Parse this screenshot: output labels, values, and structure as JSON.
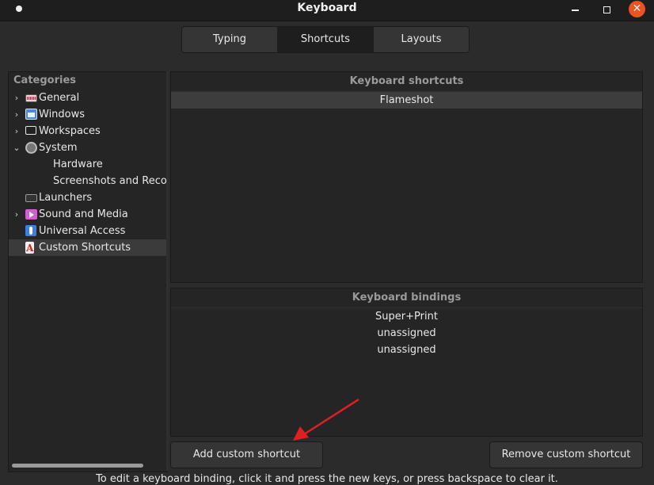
{
  "window": {
    "title": "Keyboard",
    "close_glyph": "✕",
    "close_color": "#e95420"
  },
  "tabs": [
    {
      "label": "Typing",
      "active": false
    },
    {
      "label": "Shortcuts",
      "active": true
    },
    {
      "label": "Layouts",
      "active": false
    }
  ],
  "categories": {
    "header": "Categories",
    "items": [
      {
        "label": "General",
        "icon": "keyboard-icon",
        "expander": "›"
      },
      {
        "label": "Windows",
        "icon": "windows-icon",
        "expander": "›"
      },
      {
        "label": "Workspaces",
        "icon": "monitor-icon",
        "expander": "›"
      },
      {
        "label": "System",
        "icon": "system-icon",
        "expander": "⌄"
      },
      {
        "label": "Hardware"
      },
      {
        "label": "Screenshots and Recording"
      },
      {
        "label": "Launchers",
        "icon": "launchers-icon"
      },
      {
        "label": "Sound and Media",
        "icon": "sound-icon",
        "expander": "›"
      },
      {
        "label": "Universal Access",
        "icon": "accessibility-icon"
      },
      {
        "label": "Custom Shortcuts",
        "icon": "custom-shortcuts-icon",
        "selected": true
      }
    ]
  },
  "shortcuts": {
    "header": "Keyboard shortcuts",
    "rows": [
      "Flameshot"
    ]
  },
  "bindings": {
    "header": "Keyboard bindings",
    "rows": [
      "Super+Print",
      "unassigned",
      "unassigned"
    ]
  },
  "buttons": {
    "add": "Add custom shortcut",
    "remove": "Remove custom shortcut"
  },
  "hint": "To edit a keyboard binding, click it and press the new keys, or press backspace to clear it.",
  "annotation": {
    "arrow_color": "#e02020"
  }
}
